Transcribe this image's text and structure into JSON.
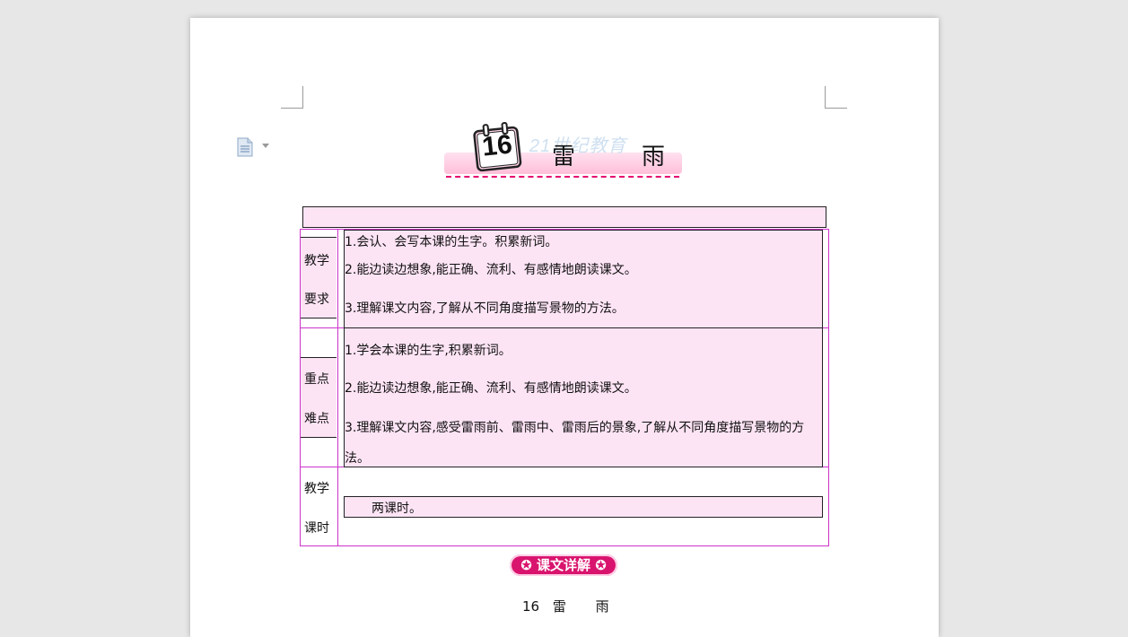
{
  "header": {
    "lesson_number": "16",
    "title_char_1": "雷",
    "title_char_2": "雨",
    "watermark": "21世纪教育"
  },
  "table": {
    "rows": [
      {
        "label_line1": "教学",
        "label_line2": "要求",
        "items": [
          "1.会认、会写本课的生字。积累新词。",
          "2.能边读边想象,能正确、流利、有感情地朗读课文。",
          "3.理解课文内容,了解从不同角度描写景物的方法。"
        ]
      },
      {
        "label_line1": "重点",
        "label_line2": "难点",
        "items": [
          "1.学会本课的生字,积累新词。",
          "2.能边读边想象,能正确、流利、有感情地朗读课文。",
          "3.理解课文内容,感受雷雨前、雷雨中、雷雨后的景象,了解从不同角度描写景物的方",
          "法。"
        ]
      },
      {
        "label_line1": "教学",
        "label_line2": "课时",
        "items": [
          "两课时。"
        ]
      }
    ]
  },
  "section_badge": "✪ 课文详解 ✪",
  "footer": {
    "number": "16",
    "char_1": "雷",
    "char_2": "雨"
  },
  "colors": {
    "table_fill": "#fde4f5",
    "table_border": "#cc33cc",
    "badge": "#d9146e",
    "banner_dash": "#e4006f"
  },
  "icons": [
    "document-icon",
    "dropdown-caret-icon",
    "calendar-icon"
  ]
}
